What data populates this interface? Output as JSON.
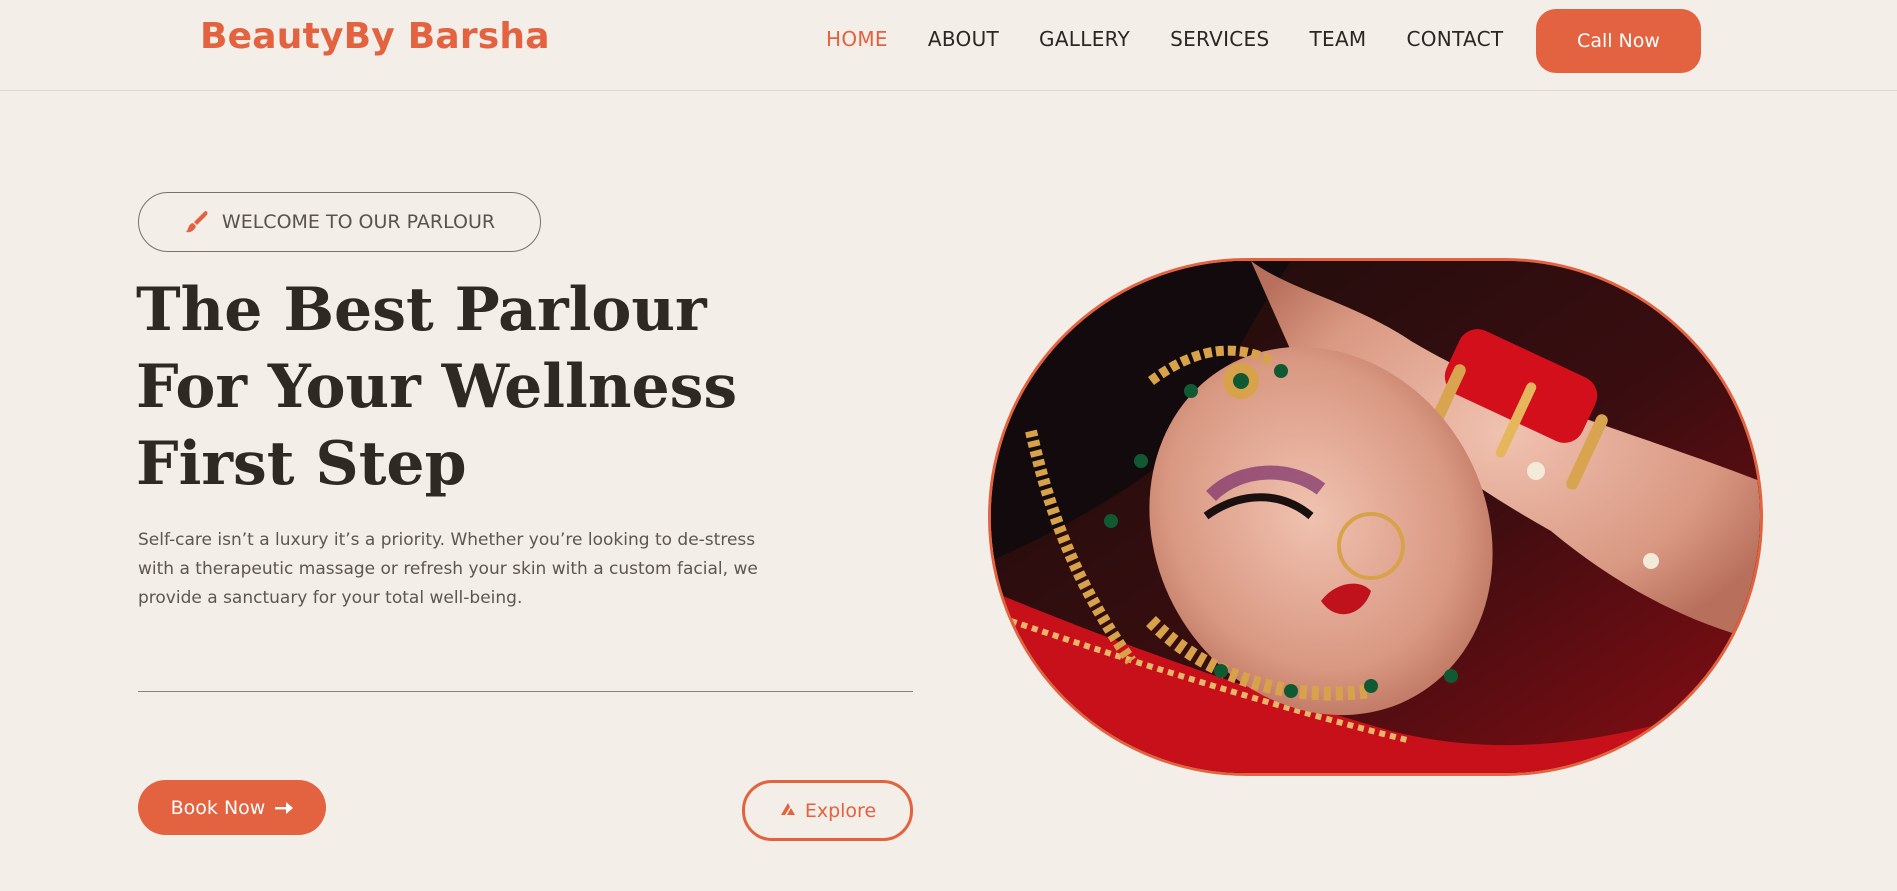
{
  "brand": "BeautyBy Barsha",
  "nav": {
    "items": [
      "HOME",
      "ABOUT",
      "GALLERY",
      "SERVICES",
      "TEAM",
      "CONTACT"
    ],
    "active": "HOME"
  },
  "header": {
    "cta_label": "Call Now"
  },
  "hero": {
    "badge_icon": "brush-icon",
    "badge_text": "WELCOME TO OUR PARLOUR",
    "title": "The Best Parlour For Your Wellness First Step",
    "description": "Self-care isn’t a luxury it’s a priority. Whether you’re looking to de-stress with a therapeutic massage or refresh your skin with a custom facial, we provide a sanctuary for your total well-being.",
    "primary_button": {
      "label": "Book Now",
      "icon": "arrow-right-icon"
    },
    "secondary_button": {
      "label": "Explore",
      "icon": "explore-icon"
    },
    "image_alt": "Bride with bridal jewellery, red bangles and makeup"
  },
  "colors": {
    "accent": "#e3623f",
    "background": "#f4eee9",
    "text_dark": "#2f2924",
    "text_muted": "#5d5650"
  }
}
